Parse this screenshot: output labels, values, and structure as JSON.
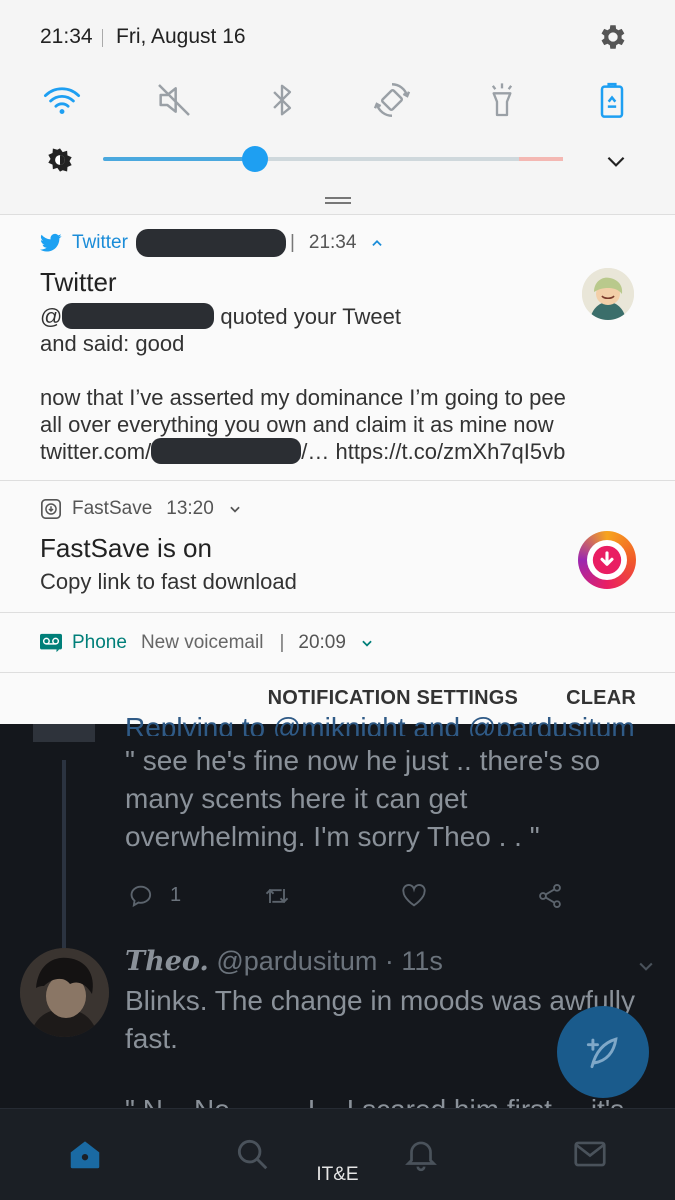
{
  "status_bar": {
    "time": "21:34",
    "date": "Fri, August 16"
  },
  "quick_settings": {
    "tiles": [
      {
        "name": "wifi-icon",
        "active": true
      },
      {
        "name": "mute-icon",
        "active": false
      },
      {
        "name": "bluetooth-icon",
        "active": false
      },
      {
        "name": "auto-rotate-icon",
        "active": false
      },
      {
        "name": "flashlight-icon",
        "active": false
      },
      {
        "name": "power-saving-icon",
        "active": true
      }
    ],
    "brightness_level": 0.33,
    "accent_color": "#1e9ff2"
  },
  "notifications": {
    "twitter": {
      "app_name": "Twitter",
      "time": "21:34",
      "title": "Twitter",
      "line1_prefix": "@",
      "line1_suffix": "quoted your Tweet",
      "line2": "and said: good",
      "body1": "now that I’ve asserted my dominance I’m going to pee",
      "body2": "all over everything you own and claim it as mine now",
      "link_prefix": "twitter.com/",
      "link_suffix": "/… https://t.co/zmXh7qI5vb",
      "brand_color": "#1da1f2"
    },
    "fastsave": {
      "app_name": "FastSave",
      "time": "13:20",
      "title": "FastSave is on",
      "text": "Copy link to fast download"
    },
    "phone": {
      "app_name": "Phone",
      "subtitle": "New voicemail",
      "time": "20:09",
      "brand_color": "#007f79"
    },
    "actions": {
      "settings_label": "NOTIFICATION SETTINGS",
      "clear_label": "CLEAR"
    }
  },
  "background_app": {
    "replying_to": "Replying to @miknight and @pardusitum",
    "tweet1": "\" see he's fine now he just .. there's so many scents here it can get overwhelming. I'm sorry Theo . . \"",
    "reply_count": "1",
    "tweet2_name": "Theo.",
    "tweet2_meta": "@pardusitum · 11s",
    "tweet2_text": "Blinks. The change in moods was awfully fast.",
    "tweet3_text": "\" N .. No ........ I .. I scared him first ... it's"
  },
  "nav_bar": {
    "carrier": "IT&E",
    "items": [
      "home-icon",
      "search-icon",
      "notifications-icon",
      "messages-icon"
    ]
  }
}
